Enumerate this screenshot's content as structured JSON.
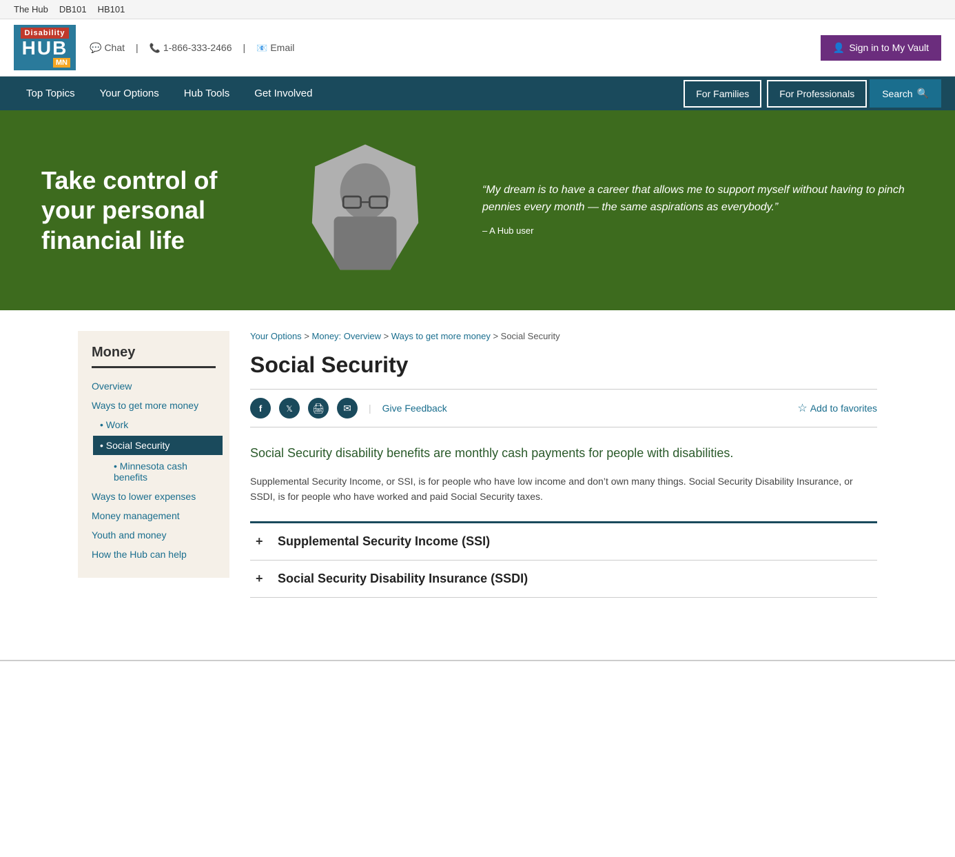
{
  "topBar": {
    "links": [
      {
        "label": "The Hub",
        "href": "#"
      },
      {
        "label": "DB101",
        "href": "#"
      },
      {
        "label": "HB101",
        "href": "#"
      }
    ]
  },
  "header": {
    "logo": {
      "disability": "Disability",
      "hub": "HUB",
      "mn": "MN"
    },
    "contact": {
      "chat_label": "Chat",
      "phone": "1-866-333-2466",
      "email": "Email"
    },
    "signin": "Sign in to My Vault"
  },
  "nav": {
    "items": [
      {
        "label": "Top Topics"
      },
      {
        "label": "Your Options"
      },
      {
        "label": "Hub Tools"
      },
      {
        "label": "Get Involved"
      }
    ],
    "buttons": [
      {
        "label": "For Families"
      },
      {
        "label": "For Professionals"
      }
    ],
    "search_label": "Search"
  },
  "hero": {
    "headline": "Take control of your personal financial life",
    "quote": "“My dream is to have a career that allows me to support myself without having to pinch pennies every month — the same aspirations as everybody.”",
    "cite": "– A Hub user"
  },
  "sidebar": {
    "title": "Money",
    "items": [
      {
        "label": "Overview",
        "level": 0,
        "active": false
      },
      {
        "label": "Ways to get more money",
        "level": 0,
        "active": false
      },
      {
        "label": "Work",
        "level": 1,
        "active": false
      },
      {
        "label": "Social Security",
        "level": 1,
        "active": true
      },
      {
        "label": "Minnesota cash benefits",
        "level": 2,
        "active": false
      },
      {
        "label": "Ways to lower expenses",
        "level": 0,
        "active": false
      },
      {
        "label": "Money management",
        "level": 0,
        "active": false
      },
      {
        "label": "Youth and money",
        "level": 0,
        "active": false
      },
      {
        "label": "How the Hub can help",
        "level": 0,
        "active": false
      }
    ]
  },
  "breadcrumb": {
    "items": [
      {
        "label": "Your Options",
        "href": "#"
      },
      {
        "label": "Money: Overview",
        "href": "#"
      },
      {
        "label": "Ways to get more money",
        "href": "#"
      },
      {
        "label": "Social Security",
        "href": null
      }
    ]
  },
  "page": {
    "title": "Social Security",
    "intro": "Social Security disability benefits are monthly cash payments for people with disabilities.",
    "body": "Supplemental Security Income, or SSI, is for people who have low income and don’t own many things. Social Security Disability Insurance, or SSDI, is for people who have worked and paid Social Security taxes.",
    "give_feedback": "Give Feedback",
    "add_favorites": "Add to favorites",
    "accordion_items": [
      {
        "title": "Supplemental Security Income (SSI)"
      },
      {
        "title": "Social Security Disability Insurance (SSDI)"
      }
    ]
  }
}
